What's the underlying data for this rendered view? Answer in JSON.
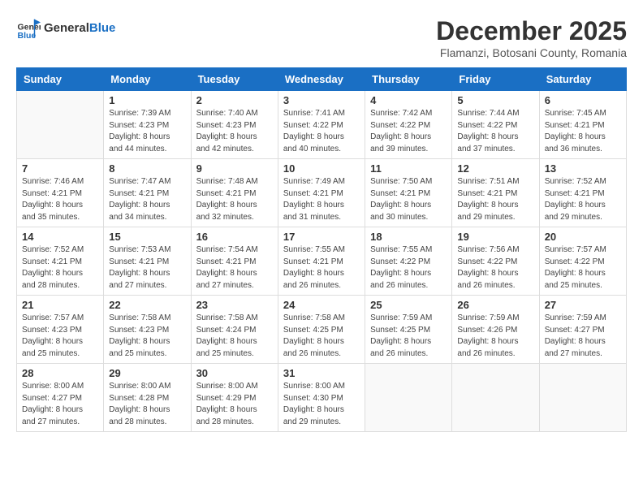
{
  "logo": {
    "text_general": "General",
    "text_blue": "Blue"
  },
  "header": {
    "month": "December 2025",
    "location": "Flamanzi, Botosani County, Romania"
  },
  "weekdays": [
    "Sunday",
    "Monday",
    "Tuesday",
    "Wednesday",
    "Thursday",
    "Friday",
    "Saturday"
  ],
  "weeks": [
    [
      {
        "day": "",
        "info": ""
      },
      {
        "day": "1",
        "info": "Sunrise: 7:39 AM\nSunset: 4:23 PM\nDaylight: 8 hours\nand 44 minutes."
      },
      {
        "day": "2",
        "info": "Sunrise: 7:40 AM\nSunset: 4:23 PM\nDaylight: 8 hours\nand 42 minutes."
      },
      {
        "day": "3",
        "info": "Sunrise: 7:41 AM\nSunset: 4:22 PM\nDaylight: 8 hours\nand 40 minutes."
      },
      {
        "day": "4",
        "info": "Sunrise: 7:42 AM\nSunset: 4:22 PM\nDaylight: 8 hours\nand 39 minutes."
      },
      {
        "day": "5",
        "info": "Sunrise: 7:44 AM\nSunset: 4:22 PM\nDaylight: 8 hours\nand 37 minutes."
      },
      {
        "day": "6",
        "info": "Sunrise: 7:45 AM\nSunset: 4:21 PM\nDaylight: 8 hours\nand 36 minutes."
      }
    ],
    [
      {
        "day": "7",
        "info": "Sunrise: 7:46 AM\nSunset: 4:21 PM\nDaylight: 8 hours\nand 35 minutes."
      },
      {
        "day": "8",
        "info": "Sunrise: 7:47 AM\nSunset: 4:21 PM\nDaylight: 8 hours\nand 34 minutes."
      },
      {
        "day": "9",
        "info": "Sunrise: 7:48 AM\nSunset: 4:21 PM\nDaylight: 8 hours\nand 32 minutes."
      },
      {
        "day": "10",
        "info": "Sunrise: 7:49 AM\nSunset: 4:21 PM\nDaylight: 8 hours\nand 31 minutes."
      },
      {
        "day": "11",
        "info": "Sunrise: 7:50 AM\nSunset: 4:21 PM\nDaylight: 8 hours\nand 30 minutes."
      },
      {
        "day": "12",
        "info": "Sunrise: 7:51 AM\nSunset: 4:21 PM\nDaylight: 8 hours\nand 29 minutes."
      },
      {
        "day": "13",
        "info": "Sunrise: 7:52 AM\nSunset: 4:21 PM\nDaylight: 8 hours\nand 29 minutes."
      }
    ],
    [
      {
        "day": "14",
        "info": "Sunrise: 7:52 AM\nSunset: 4:21 PM\nDaylight: 8 hours\nand 28 minutes."
      },
      {
        "day": "15",
        "info": "Sunrise: 7:53 AM\nSunset: 4:21 PM\nDaylight: 8 hours\nand 27 minutes."
      },
      {
        "day": "16",
        "info": "Sunrise: 7:54 AM\nSunset: 4:21 PM\nDaylight: 8 hours\nand 27 minutes."
      },
      {
        "day": "17",
        "info": "Sunrise: 7:55 AM\nSunset: 4:21 PM\nDaylight: 8 hours\nand 26 minutes."
      },
      {
        "day": "18",
        "info": "Sunrise: 7:55 AM\nSunset: 4:22 PM\nDaylight: 8 hours\nand 26 minutes."
      },
      {
        "day": "19",
        "info": "Sunrise: 7:56 AM\nSunset: 4:22 PM\nDaylight: 8 hours\nand 26 minutes."
      },
      {
        "day": "20",
        "info": "Sunrise: 7:57 AM\nSunset: 4:22 PM\nDaylight: 8 hours\nand 25 minutes."
      }
    ],
    [
      {
        "day": "21",
        "info": "Sunrise: 7:57 AM\nSunset: 4:23 PM\nDaylight: 8 hours\nand 25 minutes."
      },
      {
        "day": "22",
        "info": "Sunrise: 7:58 AM\nSunset: 4:23 PM\nDaylight: 8 hours\nand 25 minutes."
      },
      {
        "day": "23",
        "info": "Sunrise: 7:58 AM\nSunset: 4:24 PM\nDaylight: 8 hours\nand 25 minutes."
      },
      {
        "day": "24",
        "info": "Sunrise: 7:58 AM\nSunset: 4:25 PM\nDaylight: 8 hours\nand 26 minutes."
      },
      {
        "day": "25",
        "info": "Sunrise: 7:59 AM\nSunset: 4:25 PM\nDaylight: 8 hours\nand 26 minutes."
      },
      {
        "day": "26",
        "info": "Sunrise: 7:59 AM\nSunset: 4:26 PM\nDaylight: 8 hours\nand 26 minutes."
      },
      {
        "day": "27",
        "info": "Sunrise: 7:59 AM\nSunset: 4:27 PM\nDaylight: 8 hours\nand 27 minutes."
      }
    ],
    [
      {
        "day": "28",
        "info": "Sunrise: 8:00 AM\nSunset: 4:27 PM\nDaylight: 8 hours\nand 27 minutes."
      },
      {
        "day": "29",
        "info": "Sunrise: 8:00 AM\nSunset: 4:28 PM\nDaylight: 8 hours\nand 28 minutes."
      },
      {
        "day": "30",
        "info": "Sunrise: 8:00 AM\nSunset: 4:29 PM\nDaylight: 8 hours\nand 28 minutes."
      },
      {
        "day": "31",
        "info": "Sunrise: 8:00 AM\nSunset: 4:30 PM\nDaylight: 8 hours\nand 29 minutes."
      },
      {
        "day": "",
        "info": ""
      },
      {
        "day": "",
        "info": ""
      },
      {
        "day": "",
        "info": ""
      }
    ]
  ]
}
